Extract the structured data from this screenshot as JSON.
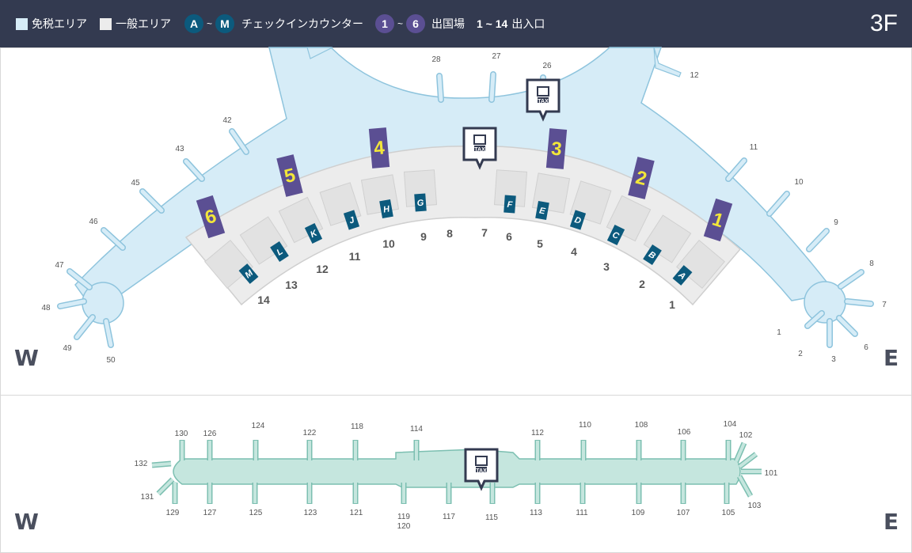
{
  "legend": {
    "duty_free": "免税エリア",
    "duty_free_color": "#d6ecf7",
    "general": "一般エリア",
    "general_color": "#ececec",
    "checkin_from": "A",
    "checkin_to": "M",
    "checkin_tilde": "~",
    "checkin_label": "チェックインカウンター",
    "checkin_color": "#0c5a7d",
    "departure_from": "1",
    "departure_to": "6",
    "departure_tilde": "~",
    "departure_label": "出国場",
    "departure_color": "#5b4f93",
    "entrance_range": "1 ~ 14",
    "entrance_label": "出入口"
  },
  "floor": "3F",
  "directions": {
    "west": "W",
    "east": "E"
  },
  "main_terminal": {
    "gates_west": [
      "50",
      "49",
      "48",
      "47",
      "46",
      "45",
      "43",
      "42"
    ],
    "gates_center": [
      "28",
      "27",
      "26"
    ],
    "gates_east": [
      "12",
      "11",
      "10",
      "9",
      "8",
      "7",
      "6",
      "3",
      "2",
      "1"
    ],
    "departures": [
      "1",
      "2",
      "3",
      "4",
      "5",
      "6"
    ],
    "checkin": [
      "A",
      "B",
      "C",
      "D",
      "E",
      "F",
      "G",
      "H",
      "J",
      "K",
      "L",
      "M"
    ],
    "entrances": [
      "1",
      "2",
      "3",
      "4",
      "5",
      "6",
      "7",
      "8",
      "9",
      "10",
      "11",
      "12",
      "13",
      "14"
    ],
    "tax_icon": "TAX"
  },
  "concourse": {
    "gates_top": [
      "130",
      "126",
      "124",
      "122",
      "118",
      "114",
      "112",
      "110",
      "108",
      "106",
      "104",
      "102"
    ],
    "gates_bottom": [
      "129",
      "127",
      "125",
      "123",
      "121",
      "119",
      "120",
      "117",
      "115",
      "113",
      "111",
      "109",
      "107",
      "105",
      "103"
    ],
    "gates_side": [
      "132",
      "131",
      "101"
    ],
    "tax_icon": "TAX"
  }
}
